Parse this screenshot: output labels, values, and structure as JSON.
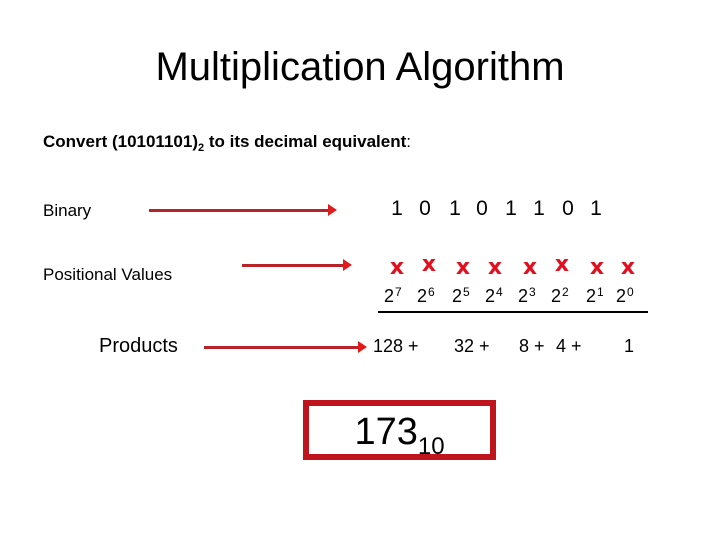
{
  "title": "Multiplication Algorithm",
  "prompt": {
    "prefix": "Convert (10101101)",
    "base_subscript": "2",
    "suffix": " to its decimal equivalent",
    "colon": ":"
  },
  "rows": {
    "binary_label": "Binary",
    "positional_label": "Positional Values",
    "products_label": "Products"
  },
  "binary_digits": [
    "1",
    "0",
    "1",
    "0",
    "1",
    "1",
    "0",
    "1"
  ],
  "multiply_symbol": "x",
  "powers": [
    {
      "base": "2",
      "exp": "7"
    },
    {
      "base": "2",
      "exp": "6"
    },
    {
      "base": "2",
      "exp": "5"
    },
    {
      "base": "2",
      "exp": "4"
    },
    {
      "base": "2",
      "exp": "3"
    },
    {
      "base": "2",
      "exp": "2"
    },
    {
      "base": "2",
      "exp": "1"
    },
    {
      "base": "2",
      "exp": "0"
    }
  ],
  "products": [
    "128 +",
    "32 +",
    "8 +",
    "4 +",
    "1"
  ],
  "result": {
    "value": "173",
    "base_subscript": "10"
  },
  "colors": {
    "arrow": "#b8232a",
    "arrowhead": "#e01b1b",
    "multiply_symbol": "#e0101e",
    "result_border": "#c0141c"
  }
}
